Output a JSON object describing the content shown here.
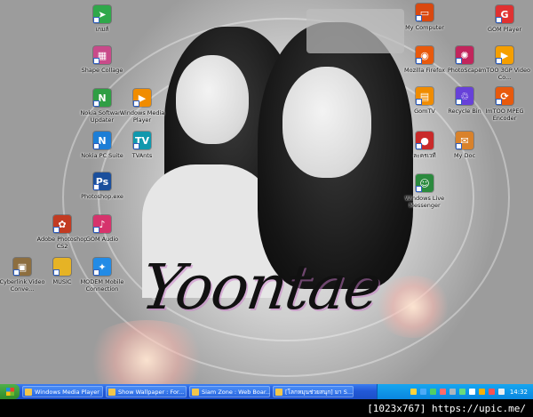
{
  "desktop": {
    "signature": "Yoontae",
    "icons": [
      {
        "label": "เกมส์",
        "icon": "arrow-icon",
        "color": "#2fa84a"
      },
      {
        "label": "Shape Collage",
        "icon": "collage-icon",
        "color": "#c94a8a"
      },
      {
        "label": "Nokia Software Updater",
        "icon": "nokia-updater-icon",
        "color": "#2f9e44"
      },
      {
        "label": "Windows Media Player",
        "icon": "media-player-icon",
        "color": "#f08c00"
      },
      {
        "label": "Nokia PC Suite",
        "icon": "nokia-suite-icon",
        "color": "#1c7ed6"
      },
      {
        "label": "TVAnts",
        "icon": "tvants-icon",
        "color": "#1098ad"
      },
      {
        "label": "Photoshop.exe",
        "icon": "photoshop-icon",
        "color": "#1b4f9c"
      },
      {
        "label": "Adobe Photoshop CS2",
        "icon": "photoshop-cs2-icon",
        "color": "#c23b22"
      },
      {
        "label": "GOM Audio",
        "icon": "gom-audio-icon",
        "color": "#d6336c"
      },
      {
        "label": "Cyberlink Video Conve...",
        "icon": "film-icon",
        "color": "#8d6e3f"
      },
      {
        "label": "MUSIC",
        "icon": "folder-icon",
        "color": "#e6b325"
      },
      {
        "label": "MODEM Mobile Connection",
        "icon": "modem-icon",
        "color": "#228be6"
      },
      {
        "label": "My Computer",
        "icon": "computer-icon",
        "color": "#d9480f"
      },
      {
        "label": "GOM Player",
        "icon": "gom-player-icon",
        "color": "#e03131"
      },
      {
        "label": "Mozilla Firefox",
        "icon": "firefox-icon",
        "color": "#e8590c"
      },
      {
        "label": "PhotoScape",
        "icon": "photoscape-icon",
        "color": "#c2255c"
      },
      {
        "label": "ImTOO 3GP Video Co...",
        "icon": "imtoo-3gp-icon",
        "color": "#f59f00"
      },
      {
        "label": "GomTV",
        "icon": "gomtv-icon",
        "color": "#f08c00"
      },
      {
        "label": "Recycle Bin",
        "icon": "recycle-bin-icon",
        "color": "#6741d9"
      },
      {
        "label": "ImTOO MPEG Encoder",
        "icon": "imtoo-mpeg-icon",
        "color": "#e8590c"
      },
      {
        "label": "ละครเวที",
        "icon": "theater-icon",
        "color": "#c92a2a"
      },
      {
        "label": "My Doc",
        "icon": "my-doc-icon",
        "color": "#d9822b"
      },
      {
        "label": "Windows Live Messenger",
        "icon": "messenger-icon",
        "color": "#2b8a3e"
      }
    ]
  },
  "taskbar": {
    "tasks": [
      {
        "label": "Windows Media Player"
      },
      {
        "label": "Show Wallpaper : For..."
      },
      {
        "label": "Siam Zone : Web Boar..."
      },
      {
        "label": "[โลกหมุนช่วยสนุก] มา S..."
      }
    ],
    "clock": "14:32"
  },
  "caption": "[1023x767] https://upic.me/"
}
